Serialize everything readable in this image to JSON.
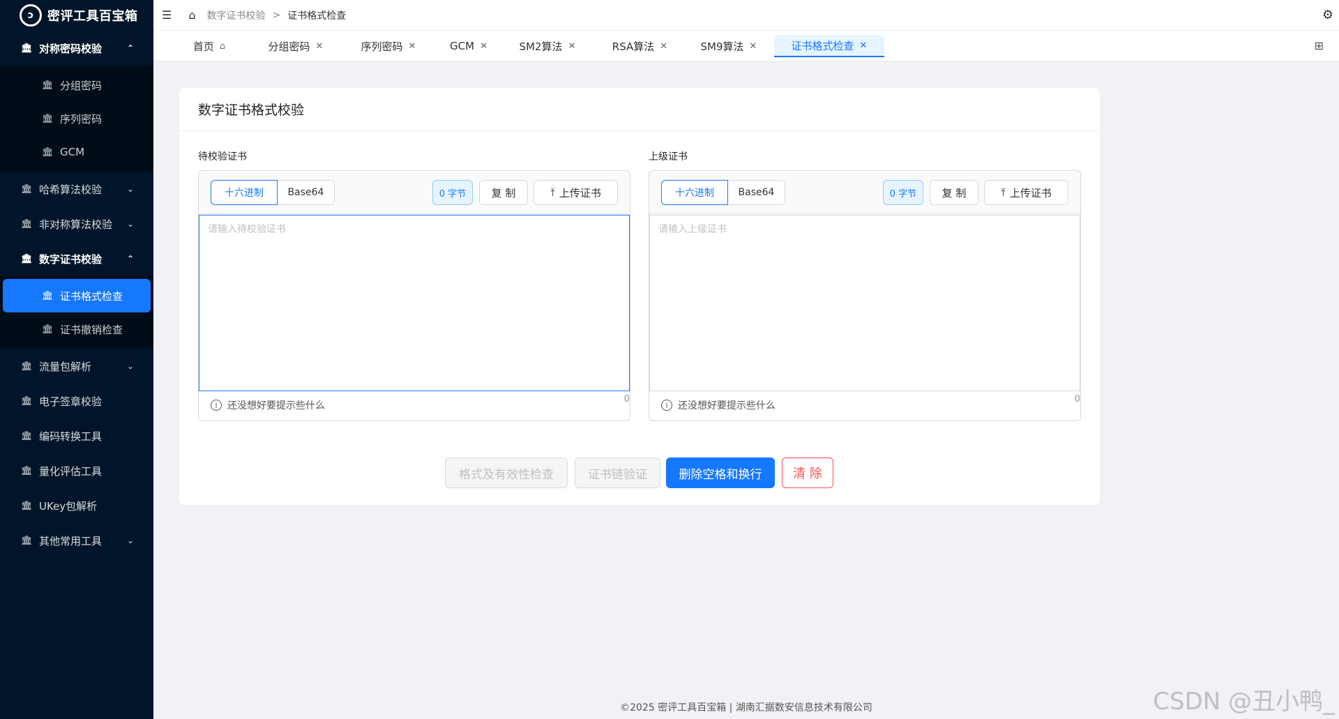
{
  "app": {
    "title": "密评工具百宝箱",
    "logo_glyph": "ↄ"
  },
  "sidebar": {
    "groups": [
      {
        "label": "对称密码校验",
        "arrow": "⌃",
        "children": [
          {
            "label": "分组密码"
          },
          {
            "label": "序列密码"
          },
          {
            "label": "GCM"
          }
        ]
      },
      {
        "label": "哈希算法校验",
        "arrow": "⌄"
      },
      {
        "label": "非对称算法校验",
        "arrow": "⌄"
      },
      {
        "label": "数字证书校验",
        "arrow": "⌃",
        "children": [
          {
            "label": "证书格式检查"
          },
          {
            "label": "证书撤销检查"
          }
        ]
      },
      {
        "label": "流量包解析",
        "arrow": "⌄"
      },
      {
        "label": "电子签章校验"
      },
      {
        "label": "编码转换工具"
      },
      {
        "label": "量化评估工具"
      },
      {
        "label": "UKey包解析"
      },
      {
        "label": "其他常用工具",
        "arrow": "⌄"
      }
    ]
  },
  "breadcrumb": {
    "parent": "数字证书校验",
    "sep": ">",
    "current": "证书格式检查"
  },
  "tabs": [
    {
      "label": "首页"
    },
    {
      "label": "分组密码"
    },
    {
      "label": "序列密码"
    },
    {
      "label": "GCM"
    },
    {
      "label": "SM2算法"
    },
    {
      "label": "RSA算法"
    },
    {
      "label": "SM9算法"
    },
    {
      "label": "证书格式检查"
    }
  ],
  "card": {
    "title": "数字证书格式校验",
    "left": {
      "label": "待校验证书",
      "seg": [
        "十六进制",
        "Base64"
      ],
      "bytes": "0 字节",
      "copy": "复 制",
      "upload": "上传证书",
      "placeholder": "请输入待校验证书",
      "counter": "0",
      "hint": "还没想好要提示些什么"
    },
    "right": {
      "label": "上级证书",
      "seg": [
        "十六进制",
        "Base64"
      ],
      "bytes": "0 字节",
      "copy": "复 制",
      "upload": "上传证书",
      "placeholder": "请输入上级证书",
      "counter": "0",
      "hint": "还没想好要提示些什么"
    },
    "actions": {
      "check": "格式及有效性检查",
      "chain": "证书链验证",
      "strip": "删除空格和换行",
      "clear": "清 除"
    }
  },
  "footer": "©2025 密评工具百宝箱 | 湖南汇据数安信息技术有限公司",
  "csdn": "CSDN @丑小鸭_",
  "colors": {
    "primary": "#1677ff",
    "sidebar": "#001529",
    "danger": "#ff4d4f"
  }
}
